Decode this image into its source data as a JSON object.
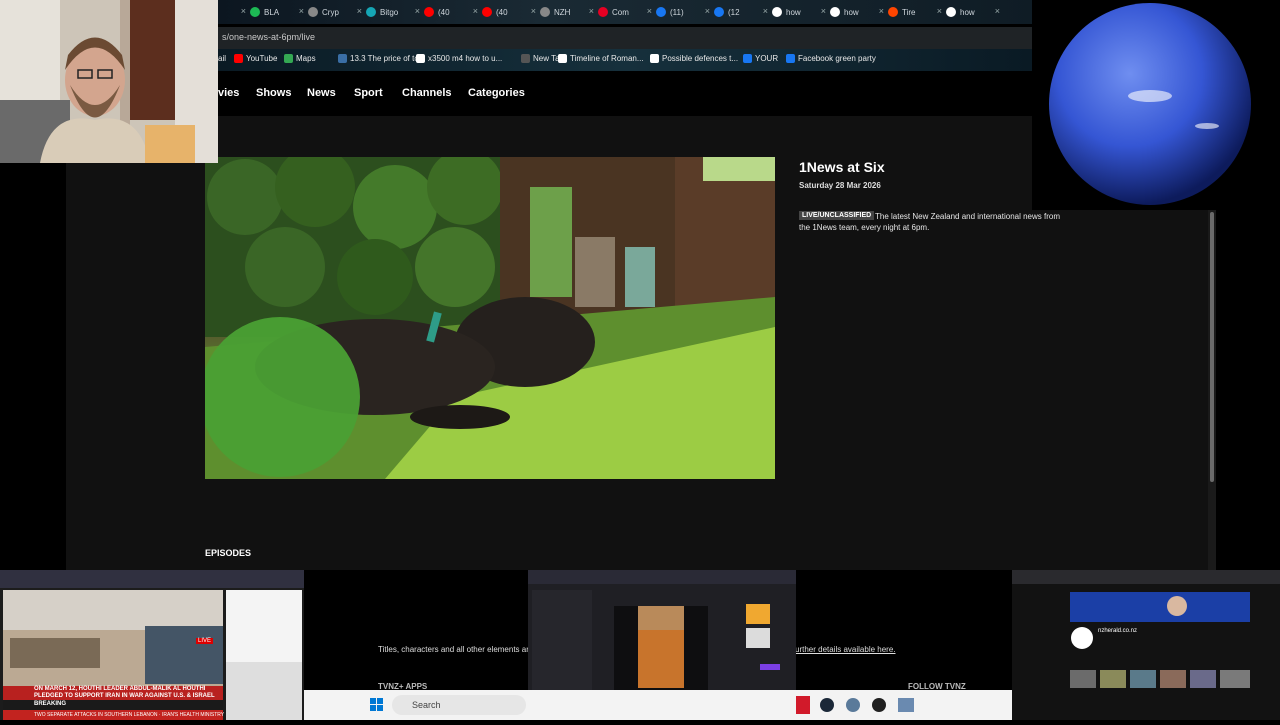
{
  "browser": {
    "tabs": [
      {
        "label": "",
        "icon": "tab-icon"
      },
      {
        "label": "BLA",
        "icon": "k-icon",
        "color": "#1db954"
      },
      {
        "label": "Cryp",
        "icon": "gear-icon",
        "color": "#888888"
      },
      {
        "label": "Bitgo",
        "icon": "s-icon",
        "color": "#15a6b5"
      },
      {
        "label": "(40",
        "icon": "youtube-icon",
        "color": "#ff0000"
      },
      {
        "label": "(40",
        "icon": "youtube-icon",
        "color": "#ff0000"
      },
      {
        "label": "NZH",
        "icon": "globe-icon",
        "color": "#888888"
      },
      {
        "label": "Com",
        "icon": "pinterest-icon",
        "color": "#e60023"
      },
      {
        "label": "(11)",
        "icon": "facebook-icon",
        "color": "#1877f2"
      },
      {
        "label": "(12",
        "icon": "facebook-icon",
        "color": "#1877f2"
      },
      {
        "label": "how",
        "icon": "google-icon",
        "color": "#ffffff"
      },
      {
        "label": "how",
        "icon": "google-icon",
        "color": "#ffffff"
      },
      {
        "label": "Tire",
        "icon": "reddit-icon",
        "color": "#ff4500"
      },
      {
        "label": "how",
        "icon": "google-icon",
        "color": "#ffffff"
      }
    ],
    "address": "s/one-news-at-6pm/live",
    "bookmarks": [
      {
        "label": "ail",
        "icon": "bookmark-icon",
        "color": "#555555"
      },
      {
        "label": "YouTube",
        "icon": "youtube-icon",
        "color": "#ff0000"
      },
      {
        "label": "Maps",
        "icon": "maps-icon",
        "color": "#34a853"
      },
      {
        "label": "13.3 The price of to...",
        "icon": "bookmark-icon",
        "color": "#3a6ea5"
      },
      {
        "label": "x3500 m4 how to u...",
        "icon": "google-icon",
        "color": "#ffffff"
      },
      {
        "label": "New Tab",
        "icon": "bookmark-icon",
        "color": "#555555"
      },
      {
        "label": "Timeline of Roman...",
        "icon": "wikipedia-icon",
        "color": "#ffffff"
      },
      {
        "label": "Possible defences t...",
        "icon": "cl-icon",
        "color": "#ffffff"
      },
      {
        "label": "YOUR",
        "icon": "facebook-icon",
        "color": "#1877f2"
      },
      {
        "label": "Facebook green party",
        "icon": "facebook-icon",
        "color": "#1877f2"
      }
    ]
  },
  "site": {
    "nav": [
      "vies",
      "Shows",
      "News",
      "Sport",
      "Channels",
      "Categories"
    ],
    "title": "1News at Six",
    "date": "Saturday 28 Mar 2026",
    "badge": "LIVE/UNCLASSIFIED",
    "description": "The latest New Zealand and international news from the 1News team, every night at 6pm.",
    "episodes_heading": "EPISODES",
    "footer_text_left": "Titles, characters and all other elements are",
    "footer_text_right": "urther details available here.",
    "footer_apps": "TVNZ+ APPS",
    "footer_follow": "FOLLOW TVNZ"
  },
  "taskbar": {
    "search_placeholder": "Search"
  },
  "overlays": {
    "news_ticker_1": "ON MARCH 12, HOUTHI LEADER ABDUL-MALIK AL HOUTHI PLEDGED TO SUPPORT IRAN IN WAR AGAINST U.S. & ISRAEL",
    "news_ticker_2": "BREAKING",
    "news_ticker_3": "TWO SEPARATE ATTACKS IN SOUTHERN LEBANON · IRAN'S HEALTH MINISTRY SAYS U.S. AND ISRAEL",
    "live_badge": "LIVE",
    "nzherald_site": "nzherald.co.nz"
  }
}
